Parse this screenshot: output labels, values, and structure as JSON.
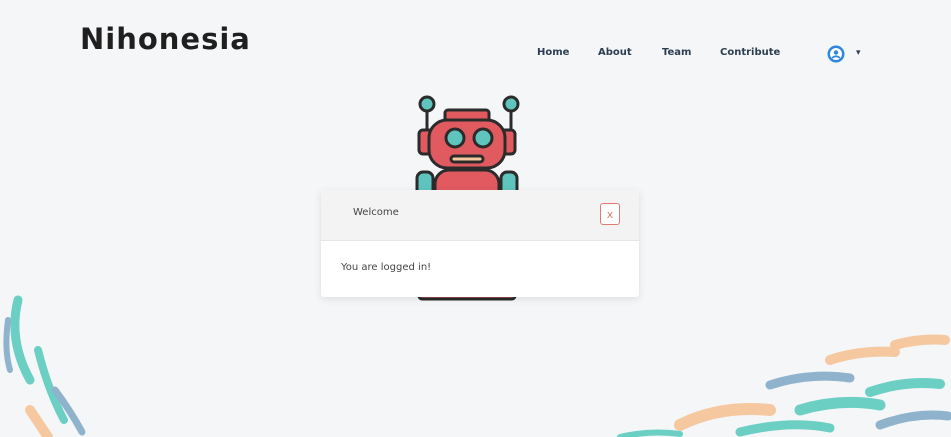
{
  "brand": {
    "name": "Nihonesia"
  },
  "nav": {
    "items": [
      {
        "label": "Home"
      },
      {
        "label": "About"
      },
      {
        "label": "Team"
      },
      {
        "label": "Contribute"
      }
    ],
    "user_menu": {
      "icon": "user-circle-icon",
      "caret": "▾"
    }
  },
  "illustration": {
    "name": "robot-icon",
    "colors": {
      "body": "#e05a5f",
      "accent": "#5fc4bd",
      "outline": "#2b2b2b"
    }
  },
  "modal": {
    "title": "Welcome",
    "close_label": "x",
    "message": "You are logged in!"
  },
  "colors": {
    "background": "#f4f6f8",
    "brush_teal": "#6ccfc4",
    "brush_peach": "#f6c8a0",
    "brush_blue": "#8fb3cc",
    "user_icon": "#2e86de"
  }
}
